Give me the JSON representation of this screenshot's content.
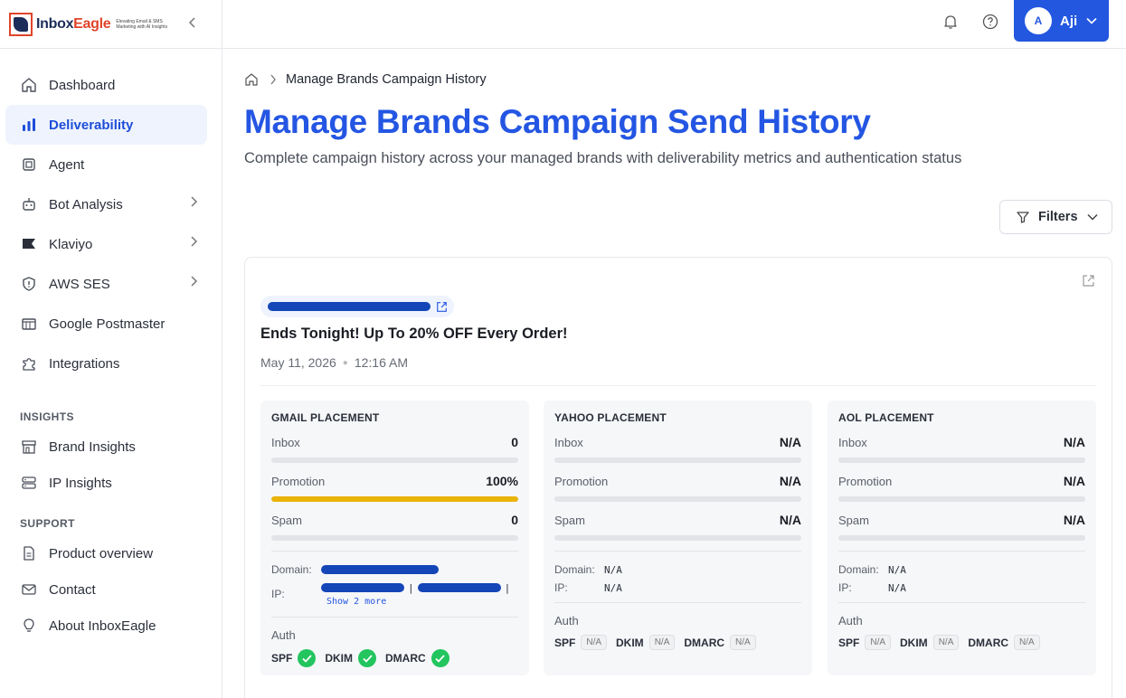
{
  "app": {
    "logo_name_part1": "Inbox",
    "logo_name_part2": "Eagle",
    "logo_tagline": "Elevating Email & SMS Marketing with AI Insights"
  },
  "sidebar": {
    "items": [
      {
        "label": "Dashboard",
        "icon": "home-icon"
      },
      {
        "label": "Deliverability",
        "icon": "bar-chart-icon",
        "active": true
      },
      {
        "label": "Agent",
        "icon": "cpu-icon"
      },
      {
        "label": "Bot Analysis",
        "icon": "bot-icon",
        "expandable": true
      },
      {
        "label": "Klaviyo",
        "icon": "flag-icon",
        "expandable": true
      },
      {
        "label": "AWS SES",
        "icon": "shield-icon",
        "expandable": true
      },
      {
        "label": "Google Postmaster",
        "icon": "mailbox-icon"
      },
      {
        "label": "Integrations",
        "icon": "puzzle-icon"
      }
    ],
    "insights_title": "INSIGHTS",
    "insights": [
      {
        "label": "Brand Insights",
        "icon": "store-icon"
      },
      {
        "label": "IP Insights",
        "icon": "server-icon"
      }
    ],
    "support_title": "SUPPORT",
    "support": [
      {
        "label": "Product overview",
        "icon": "document-icon"
      },
      {
        "label": "Contact",
        "icon": "mail-icon"
      },
      {
        "label": "About InboxEagle",
        "icon": "lightbulb-icon"
      }
    ]
  },
  "header": {
    "user_initial": "A",
    "user_name": "Aji",
    "accent": "#2357e0"
  },
  "main": {
    "breadcrumb": "Manage Brands Campaign History",
    "title": "Manage Brands Campaign Send History",
    "subtitle": "Complete campaign history across your managed brands with deliverability metrics and authentication status",
    "filters_label": "Filters"
  },
  "campaign": {
    "title": "Ends Tonight! Up To 20% OFF Every Order!",
    "date": "May 11, 2026",
    "time": "12:16 AM",
    "placements": [
      {
        "title": "GMAIL PLACEMENT",
        "metrics": [
          {
            "label": "Inbox",
            "value": "0",
            "fill": 0
          },
          {
            "label": "Promotion",
            "value": "100%",
            "fill": 1.0
          },
          {
            "label": "Spam",
            "value": "0",
            "fill": 0
          }
        ],
        "domain_label": "Domain:",
        "ip_label": "IP:",
        "show_more": "Show 2 more",
        "auth_label": "Auth",
        "auth": [
          {
            "name": "SPF",
            "status": "pass"
          },
          {
            "name": "DKIM",
            "status": "pass"
          },
          {
            "name": "DMARC",
            "status": "pass"
          }
        ]
      },
      {
        "title": "YAHOO PLACEMENT",
        "metrics": [
          {
            "label": "Inbox",
            "value": "N/A",
            "fill": 0
          },
          {
            "label": "Promotion",
            "value": "N/A",
            "fill": 0
          },
          {
            "label": "Spam",
            "value": "N/A",
            "fill": 0
          }
        ],
        "domain_label": "Domain:",
        "domain_value": "N/A",
        "ip_label": "IP:",
        "ip_value": "N/A",
        "auth_label": "Auth",
        "auth": [
          {
            "name": "SPF",
            "status": "N/A"
          },
          {
            "name": "DKIM",
            "status": "N/A"
          },
          {
            "name": "DMARC",
            "status": "N/A"
          }
        ]
      },
      {
        "title": "AOL PLACEMENT",
        "metrics": [
          {
            "label": "Inbox",
            "value": "N/A",
            "fill": 0
          },
          {
            "label": "Promotion",
            "value": "N/A",
            "fill": 0
          },
          {
            "label": "Spam",
            "value": "N/A",
            "fill": 0
          }
        ],
        "domain_label": "Domain:",
        "domain_value": "N/A",
        "ip_label": "IP:",
        "ip_value": "N/A",
        "auth_label": "Auth",
        "auth": [
          {
            "name": "SPF",
            "status": "N/A"
          },
          {
            "name": "DKIM",
            "status": "N/A"
          },
          {
            "name": "DMARC",
            "status": "N/A"
          }
        ]
      }
    ]
  }
}
